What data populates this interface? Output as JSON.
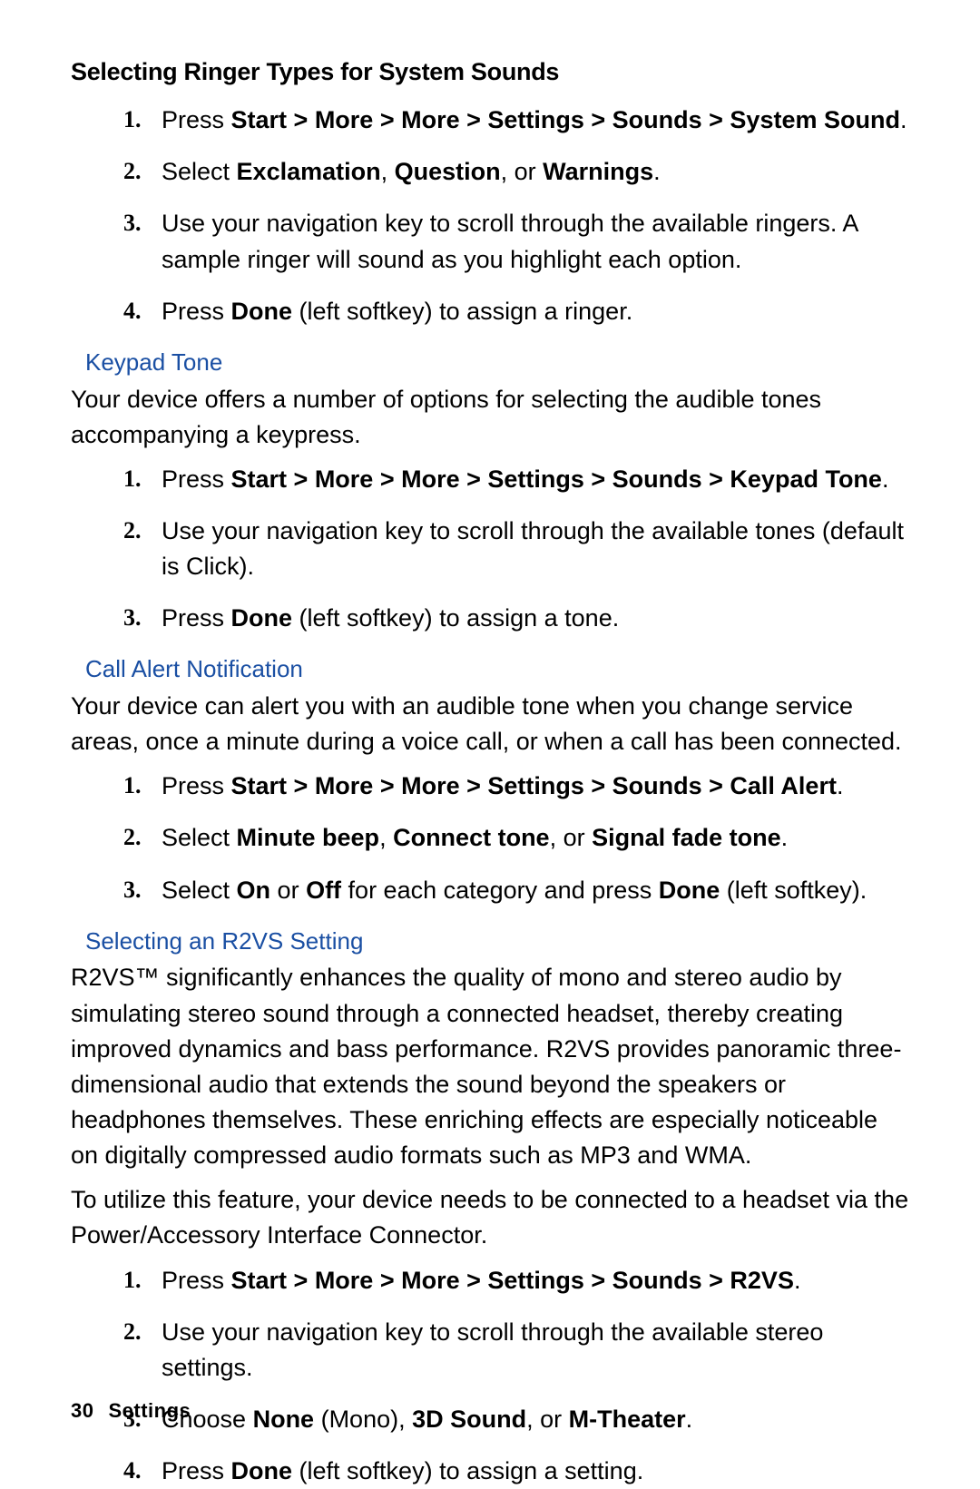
{
  "section1": {
    "title": "Selecting Ringer Types for System Sounds",
    "steps": [
      "Press <span class='bold'>Start &gt; More &gt; More &gt; Settings &gt; Sounds &gt; System Sound</span>.",
      "Select <span class='bold'>Exclamation</span>, <span class='bold'>Question</span>, or <span class='bold'>Warnings</span>.",
      "Use your navigation key to scroll through the available ringers. A sample ringer will sound as you highlight each option.",
      "Press <span class='bold'>Done</span> (left softkey) to assign a ringer."
    ]
  },
  "section2": {
    "heading": "Keypad Tone",
    "intro": "Your device offers a number of options for selecting the audible tones accompanying a keypress.",
    "steps": [
      "Press <span class='bold'>Start &gt; More &gt; More &gt; Settings &gt; Sounds &gt; Keypad Tone</span>.",
      "Use your navigation key to scroll through the available tones (default is Click).",
      "Press <span class='bold'>Done</span> (left softkey) to assign a tone."
    ]
  },
  "section3": {
    "heading": "Call Alert Notification",
    "intro": "Your device can alert you with an audible tone when you change service areas, once a minute during a voice call, or when a call has been connected.",
    "steps": [
      "Press <span class='bold'>Start &gt; More &gt; More &gt; Settings &gt; Sounds &gt; Call Alert</span>.",
      "Select <span class='bold'>Minute beep</span>, <span class='bold'>Connect tone</span>, or <span class='bold'>Signal fade tone</span>.",
      "Select <span class='bold'>On</span> or <span class='bold'>Off</span> for each category and press <span class='bold'>Done</span> (left softkey)."
    ]
  },
  "section4": {
    "heading": "Selecting an R2VS Setting",
    "intro1": "R2VS™ significantly enhances the quality of mono and stereo audio by simulating stereo sound through a connected headset, thereby creating improved dynamics and bass performance. R2VS provides panoramic three-dimensional audio that extends the sound beyond the speakers or headphones themselves. These enriching effects are especially noticeable on digitally compressed audio formats such as MP3 and WMA.",
    "intro2": "To utilize this feature, your device needs to be connected to a headset via the Power/Accessory Interface Connector.",
    "steps": [
      "Press <span class='bold'>Start &gt; More &gt; More &gt; Settings &gt; Sounds &gt; R2VS</span>.",
      "Use your navigation key to scroll through the available stereo settings.",
      "Choose <span class='bold'>None</span> (Mono), <span class='bold'>3D Sound</span>, or <span class='bold'>M-Theater</span>.",
      "Press <span class='bold'>Done</span> (left softkey) to assign a setting."
    ]
  },
  "footer": {
    "page": "30",
    "label": "Settings"
  }
}
